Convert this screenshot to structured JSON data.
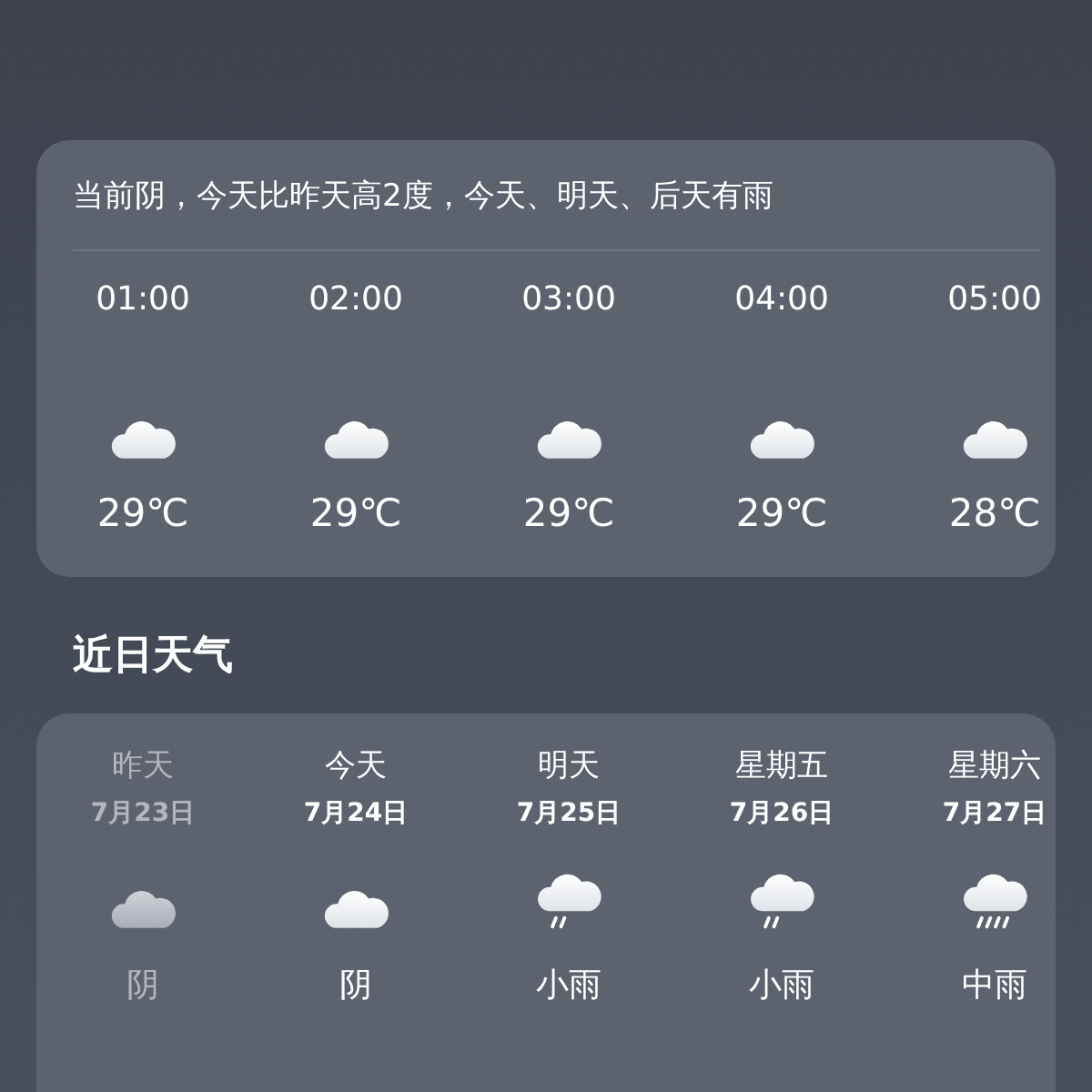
{
  "summary": "当前阴，今天比昨天高2度，今天、明天、后天有雨",
  "hourly": [
    {
      "time": "01:00",
      "kind": "cloudy",
      "temp": "29℃"
    },
    {
      "time": "02:00",
      "kind": "cloudy",
      "temp": "29℃"
    },
    {
      "time": "03:00",
      "kind": "cloudy",
      "temp": "29℃"
    },
    {
      "time": "04:00",
      "kind": "cloudy",
      "temp": "29℃"
    },
    {
      "time": "05:00",
      "kind": "cloudy",
      "temp": "28℃"
    }
  ],
  "recent_title": "近日天气",
  "daily": [
    {
      "day": "昨天",
      "date": "7月23日",
      "kind": "cloudy",
      "condition": "阴",
      "past": true
    },
    {
      "day": "今天",
      "date": "7月24日",
      "kind": "cloudy",
      "condition": "阴",
      "past": false
    },
    {
      "day": "明天",
      "date": "7月25日",
      "kind": "light_rain",
      "condition": "小雨",
      "past": false
    },
    {
      "day": "星期五",
      "date": "7月26日",
      "kind": "light_rain",
      "condition": "小雨",
      "past": false
    },
    {
      "day": "星期六",
      "date": "7月27日",
      "kind": "moderate_rain",
      "condition": "中雨",
      "past": false
    }
  ]
}
